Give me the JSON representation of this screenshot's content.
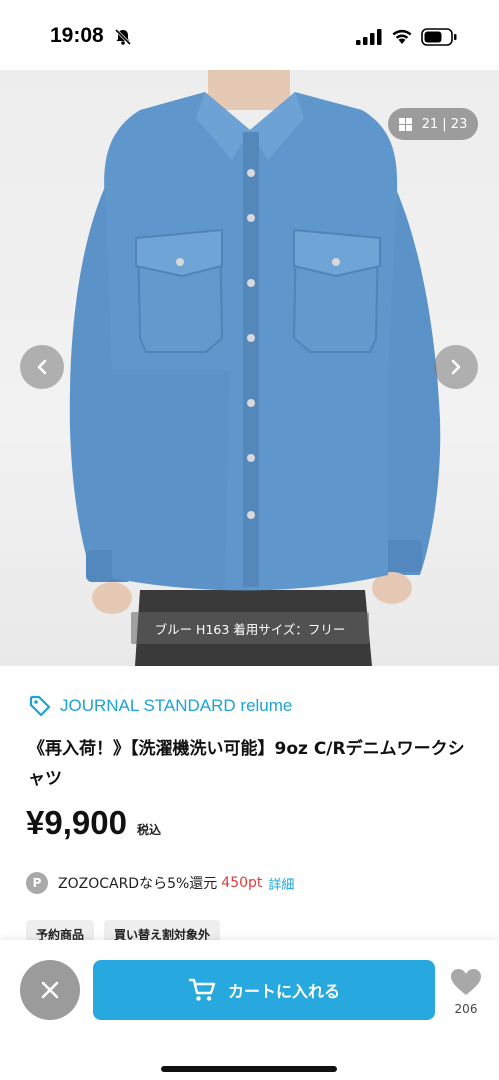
{
  "status_bar": {
    "time": "19:08"
  },
  "gallery": {
    "counter": "21 | 23",
    "caption": "ブルー H163 着用サイズ：フリー"
  },
  "product": {
    "brand": "JOURNAL STANDARD relume",
    "title": "《再入荷！》【洗濯機洗い可能】9oz C/Rデニムワークシャツ",
    "price": "¥9,900",
    "tax_label": "税込",
    "points": {
      "badge": "P",
      "text": "ZOZOCARDなら5%還元",
      "value": "450pt",
      "link": "詳細"
    },
    "tags": [
      "予約商品",
      "買い替え割対象外"
    ]
  },
  "actions": {
    "cart_label": "カートに入れる",
    "favorite_count": "206"
  },
  "colors": {
    "accent": "#27a8df",
    "brand_text": "#1ba3d6",
    "points_red": "#e23b3b",
    "denim": "#5b93c8"
  }
}
